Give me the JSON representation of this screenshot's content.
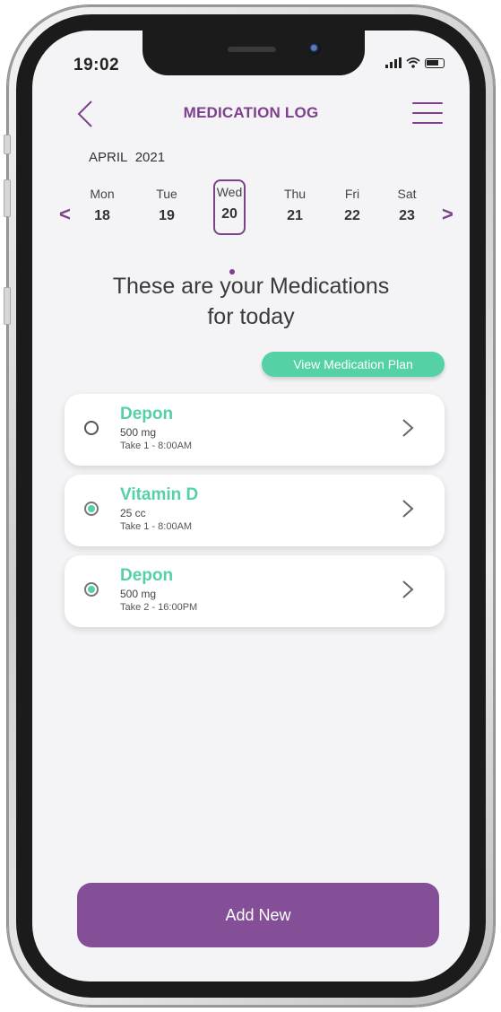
{
  "status_bar": {
    "time": "19:02"
  },
  "header": {
    "title": "MEDICATION LOG"
  },
  "calendar": {
    "month": "APRIL",
    "year": "2021",
    "days": [
      {
        "name": "Mon",
        "date": "18"
      },
      {
        "name": "Tue",
        "date": "19"
      },
      {
        "name": "Wed",
        "date": "20"
      },
      {
        "name": "Thu",
        "date": "21"
      },
      {
        "name": "Fri",
        "date": "22"
      },
      {
        "name": "Sat",
        "date": "23"
      }
    ],
    "prev_label": "<",
    "next_label": ">"
  },
  "main": {
    "headline_line1": "These are your Medications",
    "headline_line2": "for today",
    "view_plan_label": "View Medication Plan",
    "medications": [
      {
        "name": "Depon",
        "dose": "500 mg",
        "take": "Take 1  - 8:00AM",
        "taken": false
      },
      {
        "name": "Vitamin D",
        "dose": "25 cc",
        "take": "Take 1  - 8:00AM",
        "taken": true
      },
      {
        "name": "Depon",
        "dose": "500 mg",
        "take": "Take 2  - 16:00PM",
        "taken": true
      }
    ]
  },
  "footer": {
    "add_label": "Add New"
  },
  "colors": {
    "accent_purple": "#7e3f8e",
    "button_purple": "#844f96",
    "accent_green": "#54d1a5",
    "screen_bg": "#f4f3f5"
  }
}
